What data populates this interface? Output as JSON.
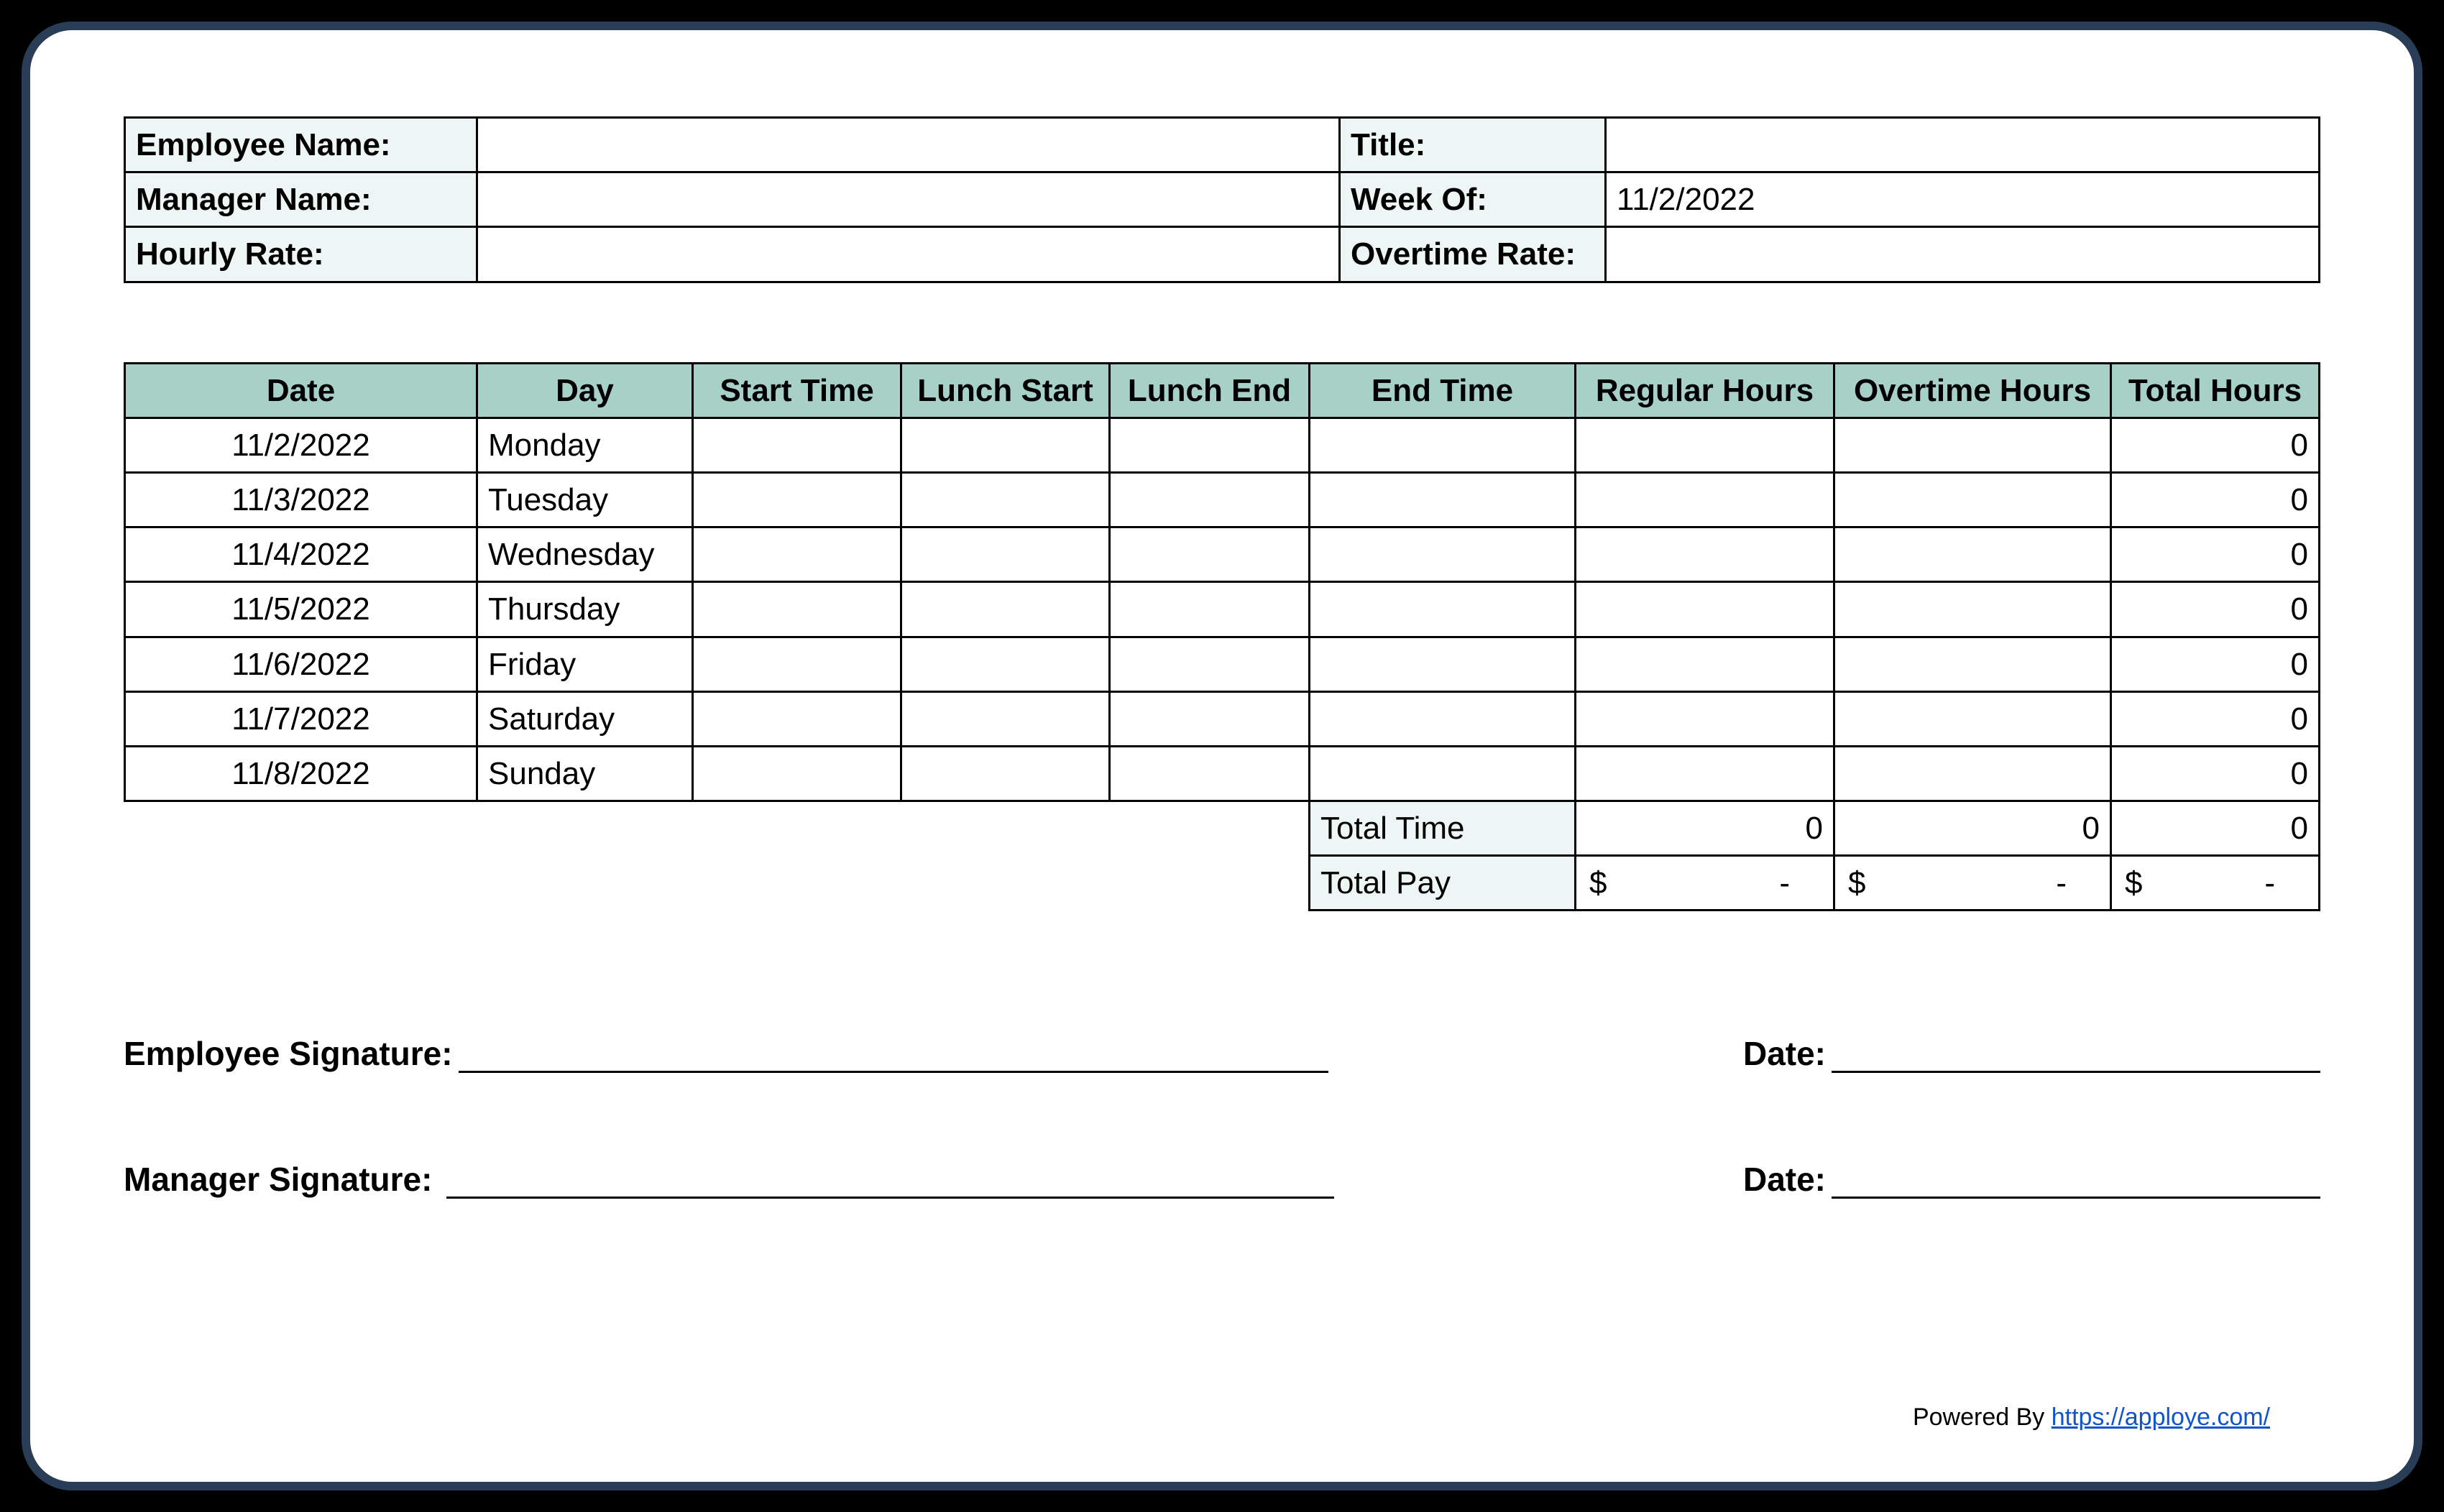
{
  "header": {
    "employee_name_label": "Employee Name:",
    "employee_name_value": "",
    "title_label": "Title:",
    "title_value": "",
    "manager_name_label": "Manager Name:",
    "manager_name_value": "",
    "week_of_label": "Week Of:",
    "week_of_value": "11/2/2022",
    "hourly_rate_label": "Hourly Rate:",
    "hourly_rate_value": "",
    "overtime_rate_label": "Overtime Rate:",
    "overtime_rate_value": ""
  },
  "columns": {
    "date": "Date",
    "day": "Day",
    "start_time": "Start Time",
    "lunch_start": "Lunch Start",
    "lunch_end": "Lunch End",
    "end_time": "End Time",
    "regular_hours": "Regular Hours",
    "overtime_hours": "Overtime Hours",
    "total_hours": "Total Hours"
  },
  "rows": [
    {
      "date": "11/2/2022",
      "day": "Monday",
      "start": "",
      "lstart": "",
      "lend": "",
      "end": "",
      "reg": "",
      "ot": "",
      "total": "0"
    },
    {
      "date": "11/3/2022",
      "day": "Tuesday",
      "start": "",
      "lstart": "",
      "lend": "",
      "end": "",
      "reg": "",
      "ot": "",
      "total": "0"
    },
    {
      "date": "11/4/2022",
      "day": "Wednesday",
      "start": "",
      "lstart": "",
      "lend": "",
      "end": "",
      "reg": "",
      "ot": "",
      "total": "0"
    },
    {
      "date": "11/5/2022",
      "day": "Thursday",
      "start": "",
      "lstart": "",
      "lend": "",
      "end": "",
      "reg": "",
      "ot": "",
      "total": "0"
    },
    {
      "date": "11/6/2022",
      "day": "Friday",
      "start": "",
      "lstart": "",
      "lend": "",
      "end": "",
      "reg": "",
      "ot": "",
      "total": "0"
    },
    {
      "date": "11/7/2022",
      "day": "Saturday",
      "start": "",
      "lstart": "",
      "lend": "",
      "end": "",
      "reg": "",
      "ot": "",
      "total": "0"
    },
    {
      "date": "11/8/2022",
      "day": "Sunday",
      "start": "",
      "lstart": "",
      "lend": "",
      "end": "",
      "reg": "",
      "ot": "",
      "total": "0"
    }
  ],
  "summary": {
    "total_time_label": "Total Time",
    "total_time_reg": "0",
    "total_time_ot": "0",
    "total_time_total": "0",
    "total_pay_label": "Total Pay",
    "total_pay_reg_sym": "$",
    "total_pay_reg_val": "-",
    "total_pay_ot_sym": "$",
    "total_pay_ot_val": "-",
    "total_pay_total_sym": "$",
    "total_pay_total_val": "-"
  },
  "signatures": {
    "employee_label": "Employee Signature:",
    "employee_date_label": "Date:",
    "manager_label": "Manager Signature:",
    "manager_date_label": "Date:"
  },
  "footer": {
    "powered_by": "Powered By ",
    "link_text": "https://apploye.com/"
  }
}
